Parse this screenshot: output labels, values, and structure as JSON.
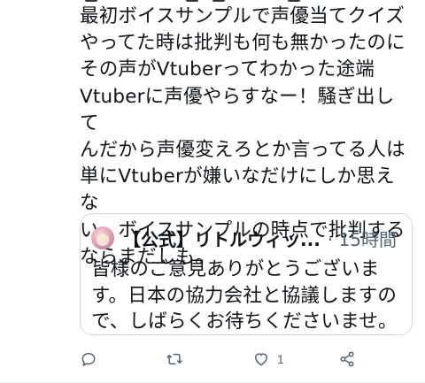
{
  "tweet": {
    "text": "最初ボイスサンプルで声優当てクイズ\nやってた時は批判も何も無かったのに\nその声がVtuberってわかった途端\nVtuberに声優やらすなー！騒ぎ出して\nんだから声優変えろとか言ってる人は\n単にVtuberが嫌いなだけにしか思えな\nい。ボイスサンプルの時点で批判する\nならまだしも。"
  },
  "quote": {
    "author_name": "【公式】リトルウィッ...",
    "time": "· 15時間",
    "text": "皆様のご意見ありがとうございま\nす。日本の協力会社と協議しますの\nで、しばらくお待ちくださいませ。",
    "avatar_icon": "avatar-image"
  },
  "actions": {
    "reply_icon": "reply-icon",
    "retweet_icon": "retweet-icon",
    "like_icon": "heart-icon",
    "like_count": "1",
    "share_icon": "share-icon"
  },
  "colors": {
    "text": "#0f1419",
    "secondary": "#536471",
    "border": "#cfd9de"
  }
}
